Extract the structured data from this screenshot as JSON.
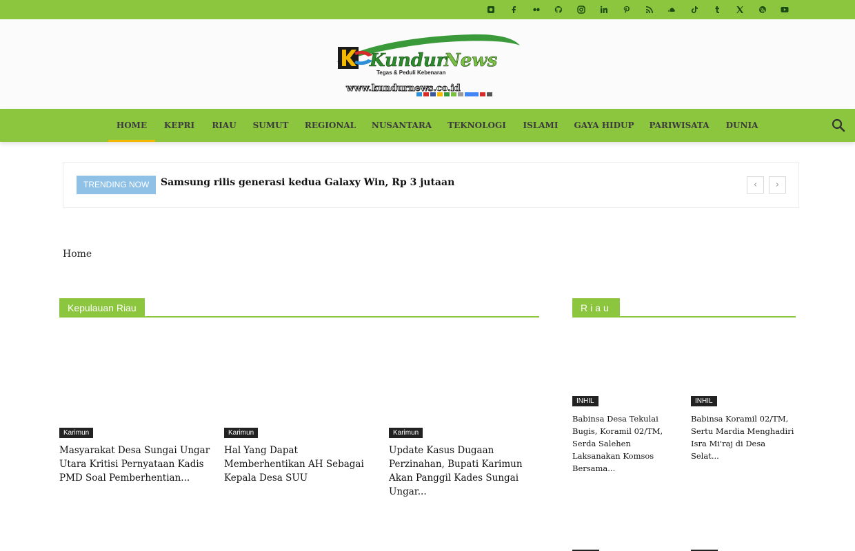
{
  "social_icons": [
    "instagram-alt-icon",
    "facebook-icon",
    "flickr-icon",
    "github-icon",
    "instagram-icon",
    "linkedin-icon",
    "pinterest-icon",
    "rss-icon",
    "soundcloud-icon",
    "tiktok-icon",
    "tumblr-icon",
    "x-twitter-icon",
    "wordpress-icon",
    "youtube-icon"
  ],
  "logo": {
    "brand": "Kundur News",
    "tagline": "Tegas & Peduli Kebenaran",
    "url": "www.kundurnews.co.id"
  },
  "nav": {
    "items": [
      "HOME",
      "KEPRI",
      "RIAU",
      "SUMUT",
      "REGIONAL",
      "NUSANTARA",
      "TEKNOLOGI",
      "ISLAMI",
      "GAYA HIDUP",
      "PARIWISATA",
      "DUNIA"
    ],
    "active": "HOME"
  },
  "trending": {
    "label": "TRENDING NOW",
    "headline": "Samsung rilis generasi kedua Galaxy Win, Rp 3 jutaan",
    "prev": "‹",
    "next": "›"
  },
  "breadcrumb": {
    "home": "Home"
  },
  "kepri_block": {
    "title": "Kepulauan Riau",
    "posts": [
      {
        "category": "Karimun",
        "title": "Masyarakat Desa Sungai Ungar Utara Kritisi Pernyataan Kadis PMD Soal Pemberhentian..."
      },
      {
        "category": "Karimun",
        "title": "Hal Yang Dapat Memberhentikan AH Sebagai Kepala Desa SUU"
      },
      {
        "category": "Karimun",
        "title": "Update Kasus Dugaan Perzinahan, Bupati Karimun Akan Panggil Kades Sungai Ungar..."
      }
    ]
  },
  "riau_block": {
    "title": "Riau",
    "posts": [
      {
        "category": "INHIL",
        "title": "Babinsa Desa Tekulai Bugis, Koramil 02/TM, Serda Salehen Laksanakan Komsos Bersama..."
      },
      {
        "category": "INHIL",
        "title": "Babinsa Koramil 02/TM, Sertu Mardia Menghadiri Isra Mi'raj di Desa Selat..."
      }
    ]
  },
  "colors": {
    "brand_green": "#8cc63f",
    "trending_blue": "#8fc0e6",
    "active_underline": "#f5b800"
  }
}
